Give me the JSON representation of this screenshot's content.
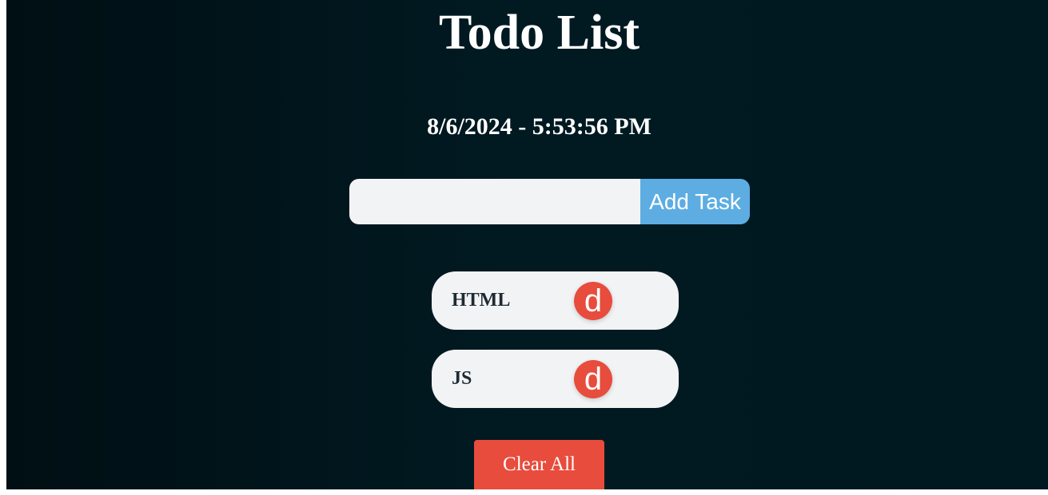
{
  "header": {
    "title": "Todo List",
    "datetime": "8/6/2024 - 5:53:56 PM"
  },
  "input": {
    "value": "",
    "placeholder": "",
    "add_label": "Add Task"
  },
  "tasks": [
    {
      "label": "HTML",
      "delete_label": "d"
    },
    {
      "label": "JS",
      "delete_label": "d"
    }
  ],
  "footer": {
    "clear_label": "Clear All"
  },
  "colors": {
    "background": "#011a22",
    "accent_blue": "#5dade2",
    "danger_red": "#e74c3c",
    "task_bg": "#f2f3f5"
  }
}
